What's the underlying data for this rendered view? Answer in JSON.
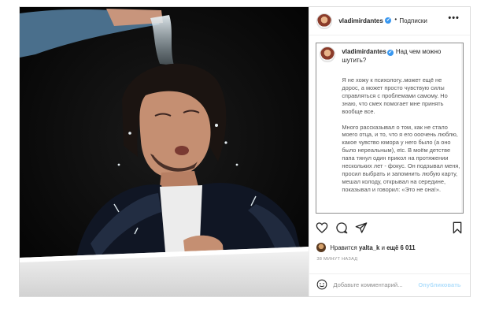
{
  "post": {
    "username": "vladimirdantes",
    "verified_mark": "✔",
    "separator": "•",
    "follow_label": "Подписки",
    "more_label": "•••"
  },
  "caption": {
    "username": "vladimirdantes",
    "first_line": "Над чем можно шутить?",
    "paragraphs": [
      "Я не хожу к психологу..может ещё не дорос, а может просто чувствую силы справляться с проблемами самому. Но знаю, что смех помогает мне принять вообще все.",
      "Много рассказывал о том, как не стало моего отца, и то, что я его ооочень люблю, какое чувство юмора у него было (а оно было нереальным), etc. В моём детстве папа тянул один прикол на протяжении нескольких лет - фокус. Он подзывал меня, просил выбрать и запомнить любую карту, мешал колоду, открывал на середине, показывал и говорил: «Это не она!»."
    ]
  },
  "actions": {
    "like_icon": "heart-icon",
    "comment_icon": "comment-icon",
    "share_icon": "paper-plane-icon",
    "save_icon": "bookmark-icon"
  },
  "likes": {
    "prefix": "Нравится",
    "user": "yalta_k",
    "conj": "и",
    "others": "ещё 6 011"
  },
  "time_ago": "38 МИНУТ НАЗАД",
  "comment": {
    "placeholder": "Добавьте комментарий...",
    "publish_label": "Опубликовать"
  },
  "colors": {
    "verified": "#3897f0",
    "publish_disabled": "#b2dffc",
    "border": "#dbdbdb"
  }
}
